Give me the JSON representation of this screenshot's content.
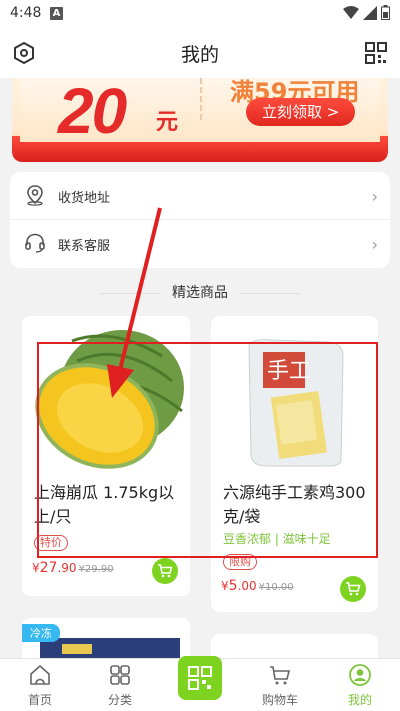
{
  "status_bar": {
    "time": "4:48",
    "notification_icon": "A"
  },
  "header": {
    "title": "我的",
    "left_icon": "settings-hex-icon",
    "right_icon": "qr-code-icon"
  },
  "banner": {
    "amount": "20",
    "unit": "元",
    "condition": "满59元可用",
    "claim_label": "立刻领取 >"
  },
  "menu": {
    "items": [
      {
        "label": "收货地址",
        "icon": "location-icon"
      },
      {
        "label": "联系客服",
        "icon": "headset-icon"
      }
    ]
  },
  "section_title": "精选商品",
  "products": [
    {
      "name": "上海崩瓜 1.75kg以上/只",
      "tag": "特价",
      "currency": "¥",
      "price": "27",
      "price_decimal": ".90",
      "original_price": "¥29.90"
    },
    {
      "name": "六源纯手工素鸡300克/袋",
      "subtitle": "豆香浓郁 | 滋味十足",
      "tag": "限购",
      "currency": "¥",
      "price": "5",
      "price_decimal": ".00",
      "original_price": "¥10.00"
    },
    {
      "badge": "冷冻"
    }
  ],
  "tabbar": {
    "items": [
      {
        "label": "首页",
        "icon": "home-icon"
      },
      {
        "label": "分类",
        "icon": "category-grid-icon"
      },
      {
        "label": "",
        "icon": "scan-icon"
      },
      {
        "label": "购物车",
        "icon": "cart-icon"
      },
      {
        "label": "我的",
        "icon": "profile-icon",
        "active": true
      }
    ]
  },
  "colors": {
    "accent_green": "#7ed321",
    "price_red": "#e73535",
    "annotation_red": "#e02020"
  }
}
